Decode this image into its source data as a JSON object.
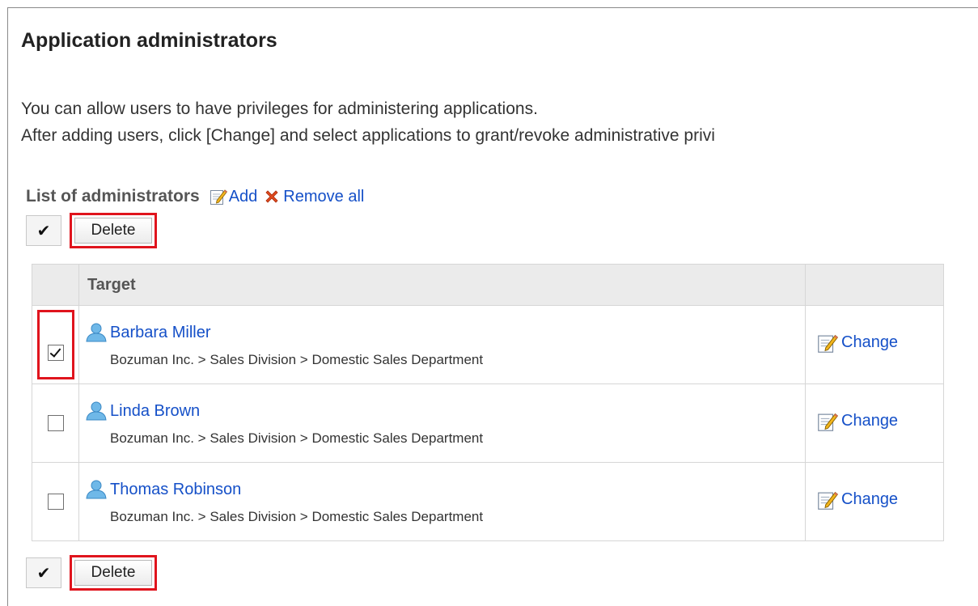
{
  "page": {
    "title": "Application administrators",
    "description_line1": "You can allow users to have privileges for administering applications.",
    "description_line2": "After adding users, click [Change] and select applications to grant/revoke administrative privi"
  },
  "list": {
    "title": "List of administrators",
    "add_label": "Add",
    "remove_all_label": "Remove all"
  },
  "toolbar": {
    "check_all_glyph": "✔",
    "delete_label": "Delete"
  },
  "table": {
    "header_target": "Target",
    "header_action": "",
    "rows": [
      {
        "name": "Barbara Miller",
        "path": "Bozuman Inc. > Sales Division > Domestic Sales Department",
        "checked": true,
        "change_label": "Change"
      },
      {
        "name": "Linda Brown",
        "path": "Bozuman Inc. > Sales Division > Domestic Sales Department",
        "checked": false,
        "change_label": "Change"
      },
      {
        "name": "Thomas Robinson",
        "path": "Bozuman Inc. > Sales Division > Domestic Sales Department",
        "checked": false,
        "change_label": "Change"
      }
    ]
  },
  "colors": {
    "link": "#1550c8",
    "highlight": "#e0141d",
    "header_bg": "#ebebeb"
  },
  "icons": {
    "add": "edit-pencil-icon",
    "remove_all": "red-x-icon",
    "user": "user-icon",
    "change": "edit-pencil-icon"
  }
}
